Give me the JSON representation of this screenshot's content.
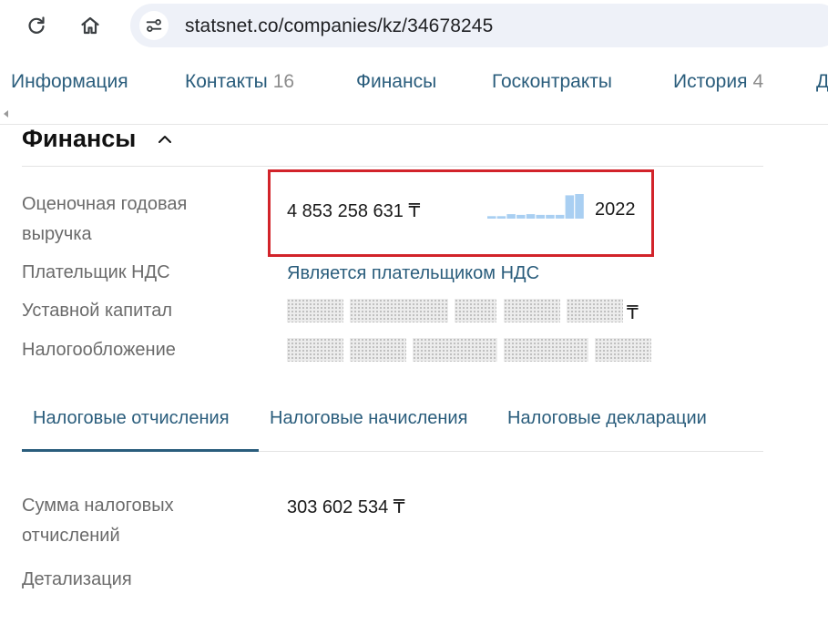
{
  "browser": {
    "url": "statsnet.co/companies/kz/34678245"
  },
  "tabs": [
    {
      "label": "Информация",
      "count": ""
    },
    {
      "label": "Контакты",
      "count": "16"
    },
    {
      "label": "Финансы",
      "count": ""
    },
    {
      "label": "Госконтракты",
      "count": ""
    },
    {
      "label": "История",
      "count": "4"
    },
    {
      "label": "Д",
      "count": ""
    }
  ],
  "section": {
    "title": "Финансы"
  },
  "rows": {
    "revenue": {
      "label_line1": "Оценочная годовая",
      "label_line2": "выручка",
      "value": "4 853 258 631 ₸",
      "year": "2022",
      "bar_levels": [
        0.1,
        0.1,
        0.18,
        0.15,
        0.18,
        0.15,
        0.15,
        0.15,
        0.95,
        1.0
      ]
    },
    "vat": {
      "label": "Плательщик НДС",
      "value": "Является плательщиком НДС"
    },
    "capital": {
      "label": "Уставной капитал",
      "currency": "₸"
    },
    "taxation": {
      "label": "Налогообложение"
    }
  },
  "subtabs": [
    {
      "label": "Налоговые отчисления"
    },
    {
      "label": "Налоговые начисления"
    },
    {
      "label": "Налоговые декларации"
    }
  ],
  "tax": {
    "label_line1": "Сумма налоговых",
    "label_line2": "отчислений",
    "value": "303 602 534 ₸"
  },
  "details": {
    "label": "Детализация"
  },
  "colors": {
    "link": "#2a5d7c",
    "highlight": "#d2232a",
    "bar": "#a9cff2"
  }
}
